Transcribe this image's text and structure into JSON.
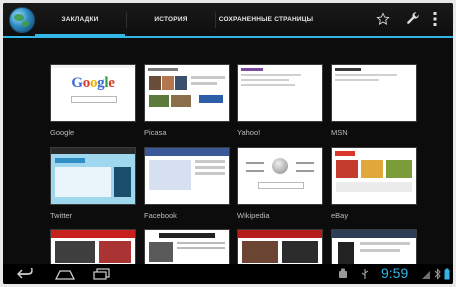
{
  "tabs": [
    {
      "label": "ЗАКЛАДКИ",
      "active": true
    },
    {
      "label": "ИСТОРИЯ",
      "active": false
    },
    {
      "label": "СОХРАНЕННЫЕ СТРАНИЦЫ",
      "active": false
    }
  ],
  "actions": {
    "star_icon": "star-icon",
    "settings_icon": "wrench-icon",
    "menu_icon": "overflow-menu-icon"
  },
  "bookmarks": [
    {
      "label": "Google",
      "thumbnail": "google"
    },
    {
      "label": "Picasa",
      "thumbnail": "picasa"
    },
    {
      "label": "Yahoo!",
      "thumbnail": "yahoo"
    },
    {
      "label": "MSN",
      "thumbnail": "msn"
    },
    {
      "label": "Twitter",
      "thumbnail": "twitter"
    },
    {
      "label": "Facebook",
      "thumbnail": "facebook"
    },
    {
      "label": "Wikipedia",
      "thumbnail": "wikipedia"
    },
    {
      "label": "eBay",
      "thumbnail": "ebay"
    },
    {
      "label": "",
      "thumbnail": "cnn"
    },
    {
      "label": "",
      "thumbnail": "nytimes"
    },
    {
      "label": "",
      "thumbnail": "news"
    },
    {
      "label": "",
      "thumbnail": "amazon"
    }
  ],
  "google_logo_letters": [
    "G",
    "o",
    "o",
    "g",
    "l",
    "e"
  ],
  "google_logo_colors": [
    "#3a6bd8",
    "#d63b2a",
    "#f0b400",
    "#3a6bd8",
    "#2f9a3a",
    "#d63b2a"
  ],
  "status_bar": {
    "time": "9:59"
  },
  "accent_color": "#33b5e5"
}
